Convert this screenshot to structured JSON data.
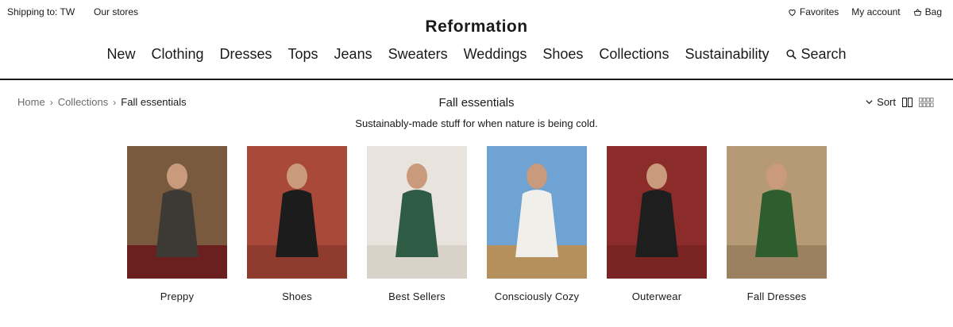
{
  "topbar": {
    "shipping": "Shipping to: TW",
    "stores": "Our stores",
    "favorites": "Favorites",
    "account": "My account",
    "bag": "Bag"
  },
  "brand": "Reformation",
  "nav": [
    "New",
    "Clothing",
    "Dresses",
    "Tops",
    "Jeans",
    "Sweaters",
    "Weddings",
    "Shoes",
    "Collections",
    "Sustainability"
  ],
  "search_label": "Search",
  "breadcrumb": {
    "home": "Home",
    "collections": "Collections",
    "current": "Fall essentials"
  },
  "page": {
    "title": "Fall essentials",
    "subtitle": "Sustainably-made stuff for when nature is being cold."
  },
  "toolbar": {
    "sort": "Sort"
  },
  "categories": [
    {
      "label": "Preppy",
      "bg": "#7a5a3e",
      "accent": "#3d3a36",
      "floor": "#6b1f1f"
    },
    {
      "label": "Shoes",
      "bg": "#a8493a",
      "accent": "#1c1c1c",
      "floor": "#8f3b2e"
    },
    {
      "label": "Best Sellers",
      "bg": "#e8e3dc",
      "accent": "#2f5c44",
      "floor": "#d9d2c8"
    },
    {
      "label": "Consciously Cozy",
      "bg": "#6ea3d3",
      "accent": "#f1efe9",
      "floor": "#b58f5c"
    },
    {
      "label": "Outerwear",
      "bg": "#8c2c2a",
      "accent": "#1e1e1e",
      "floor": "#7a2524"
    },
    {
      "label": "Fall Dresses",
      "bg": "#b69a76",
      "accent": "#2f5e2e",
      "floor": "#9b8160"
    }
  ]
}
